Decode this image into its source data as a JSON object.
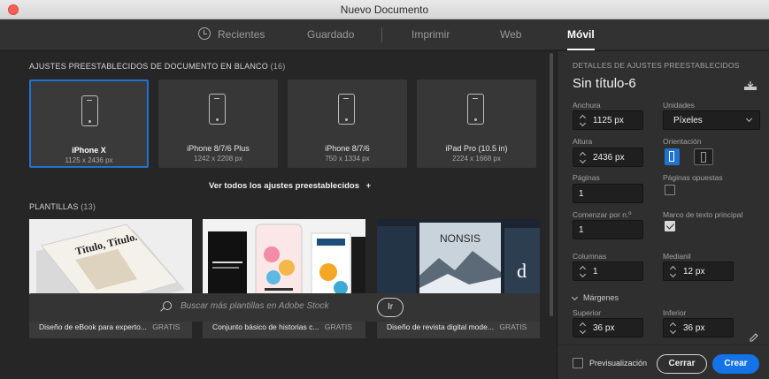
{
  "window": {
    "title": "Nuevo Documento"
  },
  "tabs": [
    {
      "label": "Recientes",
      "icon": "clock-icon"
    },
    {
      "label": "Guardado"
    },
    {
      "label": "Imprimir"
    },
    {
      "label": "Web"
    },
    {
      "label": "Móvil",
      "active": true
    }
  ],
  "presets_section": {
    "title": "AJUSTES PREESTABLECIDOS DE DOCUMENTO EN BLANCO",
    "count": "(16)",
    "items": [
      {
        "name": "iPhone X",
        "size": "1125 x 2436 px",
        "selected": true
      },
      {
        "name": "iPhone 8/7/6 Plus",
        "size": "1242 x 2208 px"
      },
      {
        "name": "iPhone 8/7/6",
        "size": "750 x 1334 px"
      },
      {
        "name": "iPad Pro (10.5 in)",
        "size": "2224 x 1668 px"
      }
    ],
    "see_all": "Ver todos los ajustes preestablecidos",
    "see_all_symbol": "+"
  },
  "templates_section": {
    "title": "PLANTILLAS",
    "count": "(13)",
    "items": [
      {
        "name": "Diseño de eBook para experto...",
        "tag": "GRATIS",
        "image_text": "Título, Título."
      },
      {
        "name": "Conjunto básico de historias c...",
        "tag": "GRATIS"
      },
      {
        "name": "Diseño de revista digital mode...",
        "tag": "GRATIS",
        "image_text": "NONSIS"
      }
    ]
  },
  "search": {
    "placeholder": "Buscar más plantillas en Adobe Stock",
    "button": "Ir"
  },
  "panel": {
    "header": "DETALLES DE AJUSTES PREESTABLECIDOS",
    "doc_name": "Sin título-6",
    "width_label": "Anchura",
    "width_value": "1125 px",
    "units_label": "Unidades",
    "units_value": "Píxeles",
    "height_label": "Altura",
    "height_value": "2436 px",
    "orientation_label": "Orientación",
    "pages_label": "Páginas",
    "pages_value": "1",
    "facing_label": "Páginas opuestas",
    "facing_checked": false,
    "start_label": "Comenzar por n.º",
    "start_value": "1",
    "master_label": "Marco de texto principal",
    "master_checked": true,
    "columns_label": "Columnas",
    "columns_value": "1",
    "gutter_label": "Medianil",
    "gutter_value": "12 px",
    "margins_label": "Márgenes",
    "top_label": "Superior",
    "top_value": "36 px",
    "bottom_label": "Inferior",
    "bottom_value": "36 px",
    "preview_label": "Previsualización",
    "close_button": "Cerrar",
    "create_button": "Crear"
  },
  "colors": {
    "accent": "#1473e6",
    "selected_border": "#1f73d1",
    "background": "#262626",
    "panel": "#2f2f2f"
  }
}
